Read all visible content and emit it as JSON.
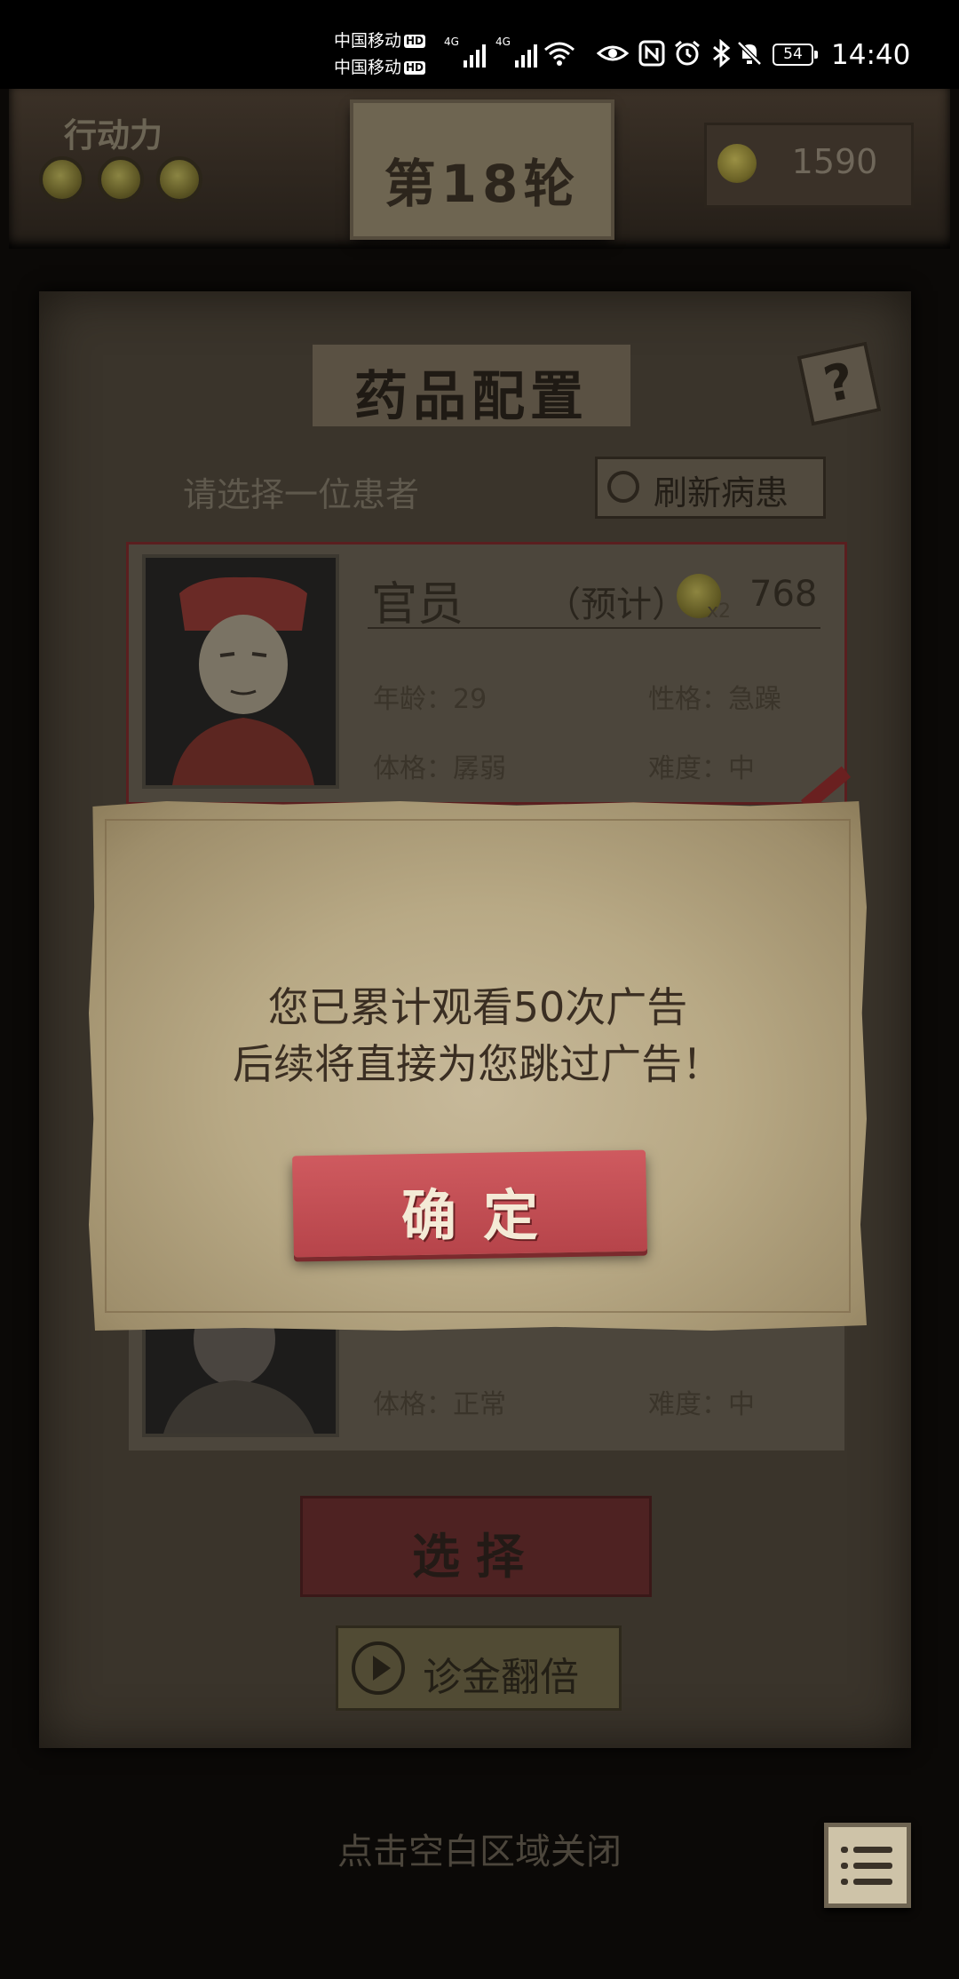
{
  "status_bar": {
    "carrier_1": "中国移动",
    "carrier_2": "中国移动",
    "hd_1": "HD",
    "hd_2": "HD",
    "network_1": "4G",
    "network_2": "4G",
    "battery": "54",
    "time": "14:40",
    "icons": [
      "wifi-icon",
      "eye-icon",
      "nfc-icon",
      "alarm-icon",
      "bluetooth-icon",
      "mute-icon"
    ]
  },
  "top_bar": {
    "action_label": "行动力",
    "action_points": 3,
    "round_text": "第18轮",
    "money": "1590"
  },
  "panel": {
    "title": "药品配置",
    "help": "?",
    "select_hint": "请选择一位患者",
    "refresh_label": "刷新病患",
    "patient_1": {
      "name": "官员",
      "estimate_label": "（预计）",
      "multiplier": "x2",
      "reward": "768",
      "age": "年龄：29",
      "personality": "性格：急躁",
      "physique": "体格：孱弱",
      "difficulty": "难度：中"
    },
    "patient_2": {
      "physique": "体格：正常",
      "difficulty": "难度：中"
    },
    "select_button": "选择",
    "double_button": "诊金翻倍",
    "close_hint": "点击空白区域关闭"
  },
  "modal": {
    "line_1": "您已累计观看50次广告",
    "line_2": "后续将直接为您跳过广告！",
    "confirm": "确定"
  },
  "colors": {
    "confirm_red": "#c24e54",
    "parchment": "#bcae8b",
    "background": "#0b0907"
  }
}
